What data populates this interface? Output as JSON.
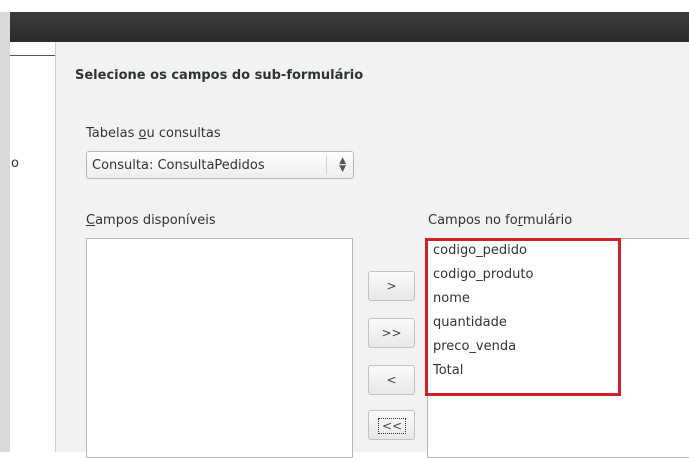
{
  "dialog": {
    "heading": "Selecione os campos do sub-formulário",
    "sidebar_fragment": "o"
  },
  "tables_label": {
    "before": "Tabelas ",
    "mnemonic": "o",
    "after": "u consultas"
  },
  "tables_select": {
    "value": "Consulta: ConsultaPedidos"
  },
  "available_label": {
    "mnemonic": "C",
    "after": "ampos disponíveis"
  },
  "available_fields": [],
  "form_label": {
    "before": "Campos no fo",
    "mnemonic": "r",
    "after": "mulário"
  },
  "form_fields": [
    "codigo_pedido",
    "codigo_produto",
    "nome",
    "quantidade",
    "preco_venda",
    "Total"
  ],
  "buttons": {
    "add_one": ">",
    "add_all": ">>",
    "remove_one": "<",
    "remove_all": "<<"
  },
  "colors": {
    "highlight_border": "#d0202a",
    "titlebar": "#2b2b2b"
  }
}
